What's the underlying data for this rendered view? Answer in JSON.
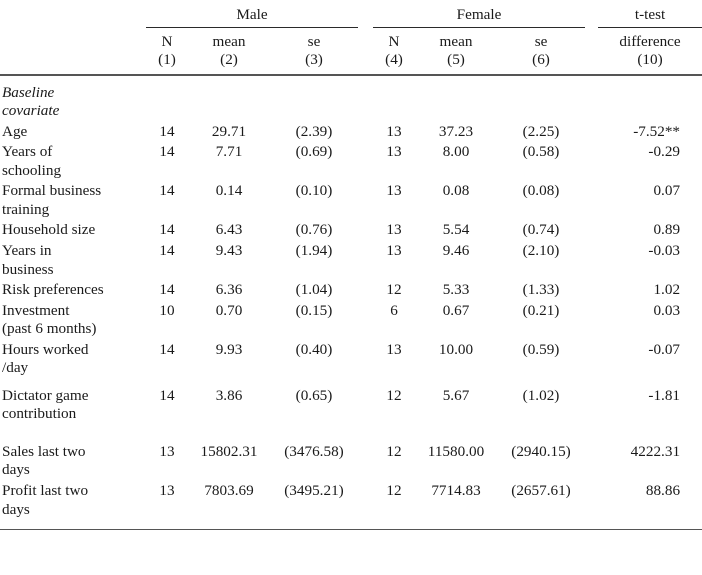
{
  "table": {
    "groups": [
      {
        "label": "",
        "rule": false
      },
      {
        "label": "Male",
        "rule": true
      },
      {
        "label": "Female",
        "rule": true
      },
      {
        "label": "t-test",
        "rule": true
      }
    ],
    "group_labels": {
      "male": "Male",
      "female": "Female",
      "ttest": "t-test"
    },
    "subheaders": {
      "male_n": "N",
      "male_n_num": "(1)",
      "male_mean": "mean",
      "male_mean_num": "(2)",
      "male_se": "se",
      "male_se_num": "(3)",
      "female_n": "N",
      "female_n_num": "(4)",
      "female_mean": "mean",
      "female_mean_num": "(5)",
      "female_se": "se",
      "female_se_num": "(6)",
      "ttest_diff": "difference",
      "ttest_diff_num": "(10)"
    },
    "section_label_line1": "Baseline",
    "section_label_line2": "covariate",
    "rows": [
      {
        "label_line1": "Age",
        "label_line2": "",
        "male_n": "14",
        "male_mean": "29.71",
        "male_se": "(2.39)",
        "female_n": "13",
        "female_mean": "37.23",
        "female_se": "(2.25)",
        "difference": "-7.52**"
      },
      {
        "label_line1": "Years of",
        "label_line2": "schooling",
        "male_n": "14",
        "male_mean": "7.71",
        "male_se": "(0.69)",
        "female_n": "13",
        "female_mean": "8.00",
        "female_se": "(0.58)",
        "difference": "-0.29"
      },
      {
        "label_line1": "Formal business",
        "label_line2": "training",
        "male_n": "14",
        "male_mean": "0.14",
        "male_se": "(0.10)",
        "female_n": "13",
        "female_mean": "0.08",
        "female_se": "(0.08)",
        "difference": "0.07"
      },
      {
        "label_line1": "Household size",
        "label_line2": "",
        "male_n": "14",
        "male_mean": "6.43",
        "male_se": "(0.76)",
        "female_n": "13",
        "female_mean": "5.54",
        "female_se": "(0.74)",
        "difference": "0.89"
      },
      {
        "label_line1": "Years in",
        "label_line2": "business",
        "male_n": "14",
        "male_mean": "9.43",
        "male_se": "(1.94)",
        "female_n": "13",
        "female_mean": "9.46",
        "female_se": "(2.10)",
        "difference": "-0.03"
      },
      {
        "label_line1": "Risk preferences",
        "label_line2": "",
        "male_n": "14",
        "male_mean": "6.36",
        "male_se": "(1.04)",
        "female_n": "12",
        "female_mean": "5.33",
        "female_se": "(1.33)",
        "difference": "1.02"
      },
      {
        "label_line1": "Investment",
        "label_line2": "(past 6 months)",
        "male_n": "10",
        "male_mean": "0.70",
        "male_se": "(0.15)",
        "female_n": "6",
        "female_mean": "0.67",
        "female_se": "(0.21)",
        "difference": "0.03"
      },
      {
        "label_line1": "Hours worked",
        "label_line2": "/day",
        "male_n": "14",
        "male_mean": "9.93",
        "male_se": "(0.40)",
        "female_n": "13",
        "female_mean": "10.00",
        "female_se": "(0.59)",
        "difference": "-0.07"
      },
      {
        "label_line1": "Dictator game",
        "label_line2": "contribution",
        "male_n": "14",
        "male_mean": "3.86",
        "male_se": "(0.65)",
        "female_n": "12",
        "female_mean": "5.67",
        "female_se": "(1.02)",
        "difference": "-1.81"
      }
    ],
    "rows_outcomes": [
      {
        "label_line1": "Sales last two",
        "label_line2": "days",
        "male_n": "13",
        "male_mean": "15802.31",
        "male_se": "(3476.58)",
        "female_n": "12",
        "female_mean": "11580.00",
        "female_se": "(2940.15)",
        "difference": "4222.31"
      },
      {
        "label_line1": "Profit last two",
        "label_line2": "days",
        "male_n": "13",
        "male_mean": "7803.69",
        "male_se": "(3495.21)",
        "female_n": "12",
        "female_mean": "7714.83",
        "female_se": "(2657.61)",
        "difference": "88.86"
      }
    ]
  },
  "chart_data": {
    "type": "table",
    "title": "",
    "column_groups": [
      "",
      "Male",
      "Female",
      "t-test"
    ],
    "columns": [
      "Baseline covariate",
      "Male N (1)",
      "Male mean (2)",
      "Male se (3)",
      "Female N (4)",
      "Female mean (5)",
      "Female se (6)",
      "t-test difference (10)"
    ],
    "rows": [
      [
        "Age",
        14,
        29.71,
        2.39,
        13,
        37.23,
        2.25,
        -7.52
      ],
      [
        "Years of schooling",
        14,
        7.71,
        0.69,
        13,
        8.0,
        0.58,
        -0.29
      ],
      [
        "Formal business training",
        14,
        0.14,
        0.1,
        13,
        0.08,
        0.08,
        0.07
      ],
      [
        "Household size",
        14,
        6.43,
        0.76,
        13,
        5.54,
        0.74,
        0.89
      ],
      [
        "Years in business",
        14,
        9.43,
        1.94,
        13,
        9.46,
        2.1,
        -0.03
      ],
      [
        "Risk preferences",
        14,
        6.36,
        1.04,
        12,
        5.33,
        1.33,
        1.02
      ],
      [
        "Investment (past 6 months)",
        10,
        0.7,
        0.15,
        6,
        0.67,
        0.21,
        0.03
      ],
      [
        "Hours worked /day",
        14,
        9.93,
        0.4,
        13,
        10.0,
        0.59,
        -0.07
      ],
      [
        "Dictator game contribution",
        14,
        3.86,
        0.65,
        12,
        5.67,
        1.02,
        -1.81
      ],
      [
        "Sales last two days",
        13,
        15802.31,
        3476.58,
        12,
        11580.0,
        2940.15,
        4222.31
      ],
      [
        "Profit last two days",
        13,
        7803.69,
        3495.21,
        12,
        7714.83,
        2657.61,
        88.86
      ]
    ],
    "significance_markers": {
      "Age": "**"
    }
  }
}
